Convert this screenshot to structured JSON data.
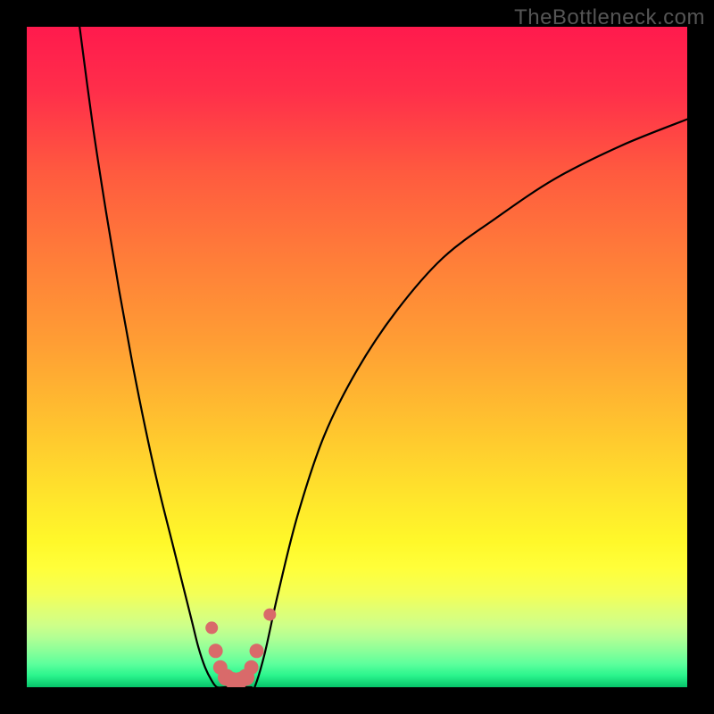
{
  "watermark": "TheBottleneck.com",
  "colors": {
    "black": "#000000",
    "curve_stroke": "#000000",
    "marker_fill": "#d96a6a"
  },
  "chart_data": {
    "type": "line",
    "title": "",
    "xlabel": "",
    "ylabel": "",
    "xlim": [
      0,
      100
    ],
    "ylim": [
      0,
      100
    ],
    "series": [
      {
        "name": "left-branch",
        "x": [
          8,
          10,
          12,
          14,
          16,
          18,
          20,
          22,
          23.5,
          25,
          26,
          27,
          28,
          28.8
        ],
        "y": [
          100,
          85,
          72,
          60,
          49,
          39,
          30,
          22,
          16,
          10,
          6,
          3,
          1,
          0
        ]
      },
      {
        "name": "valley-floor",
        "x": [
          28.8,
          30,
          31,
          32,
          33,
          34,
          34.5
        ],
        "y": [
          0,
          0,
          0,
          0,
          0,
          0,
          0
        ]
      },
      {
        "name": "right-branch",
        "x": [
          34.5,
          36,
          38,
          41,
          45,
          50,
          56,
          63,
          71,
          80,
          90,
          100
        ],
        "y": [
          0,
          5,
          14,
          26,
          38,
          48,
          57,
          65,
          71,
          77,
          82,
          86
        ]
      }
    ],
    "markers": {
      "name": "valley-markers",
      "points": [
        {
          "x": 28.0,
          "y": 9
        },
        {
          "x": 28.6,
          "y": 5.5
        },
        {
          "x": 29.3,
          "y": 3
        },
        {
          "x": 30.2,
          "y": 1.5
        },
        {
          "x": 31.2,
          "y": 1
        },
        {
          "x": 32.2,
          "y": 1
        },
        {
          "x": 33.2,
          "y": 1.5
        },
        {
          "x": 34.0,
          "y": 3
        },
        {
          "x": 34.8,
          "y": 5.5
        },
        {
          "x": 36.8,
          "y": 11
        }
      ]
    },
    "gradient_stops": [
      {
        "pos": 0.0,
        "color": "#ff1a4d"
      },
      {
        "pos": 0.1,
        "color": "#ff2f4a"
      },
      {
        "pos": 0.22,
        "color": "#ff5a3f"
      },
      {
        "pos": 0.35,
        "color": "#ff7d39"
      },
      {
        "pos": 0.48,
        "color": "#ff9e34"
      },
      {
        "pos": 0.6,
        "color": "#ffc22f"
      },
      {
        "pos": 0.7,
        "color": "#ffe12c"
      },
      {
        "pos": 0.78,
        "color": "#fff82a"
      },
      {
        "pos": 0.82,
        "color": "#ffff3a"
      },
      {
        "pos": 0.86,
        "color": "#f3ff58"
      },
      {
        "pos": 0.88,
        "color": "#e3ff70"
      },
      {
        "pos": 0.905,
        "color": "#cfff88"
      },
      {
        "pos": 0.925,
        "color": "#b2ff94"
      },
      {
        "pos": 0.945,
        "color": "#8aff99"
      },
      {
        "pos": 0.965,
        "color": "#5cff9c"
      },
      {
        "pos": 0.982,
        "color": "#2bf58d"
      },
      {
        "pos": 1.0,
        "color": "#06c46a"
      }
    ]
  }
}
